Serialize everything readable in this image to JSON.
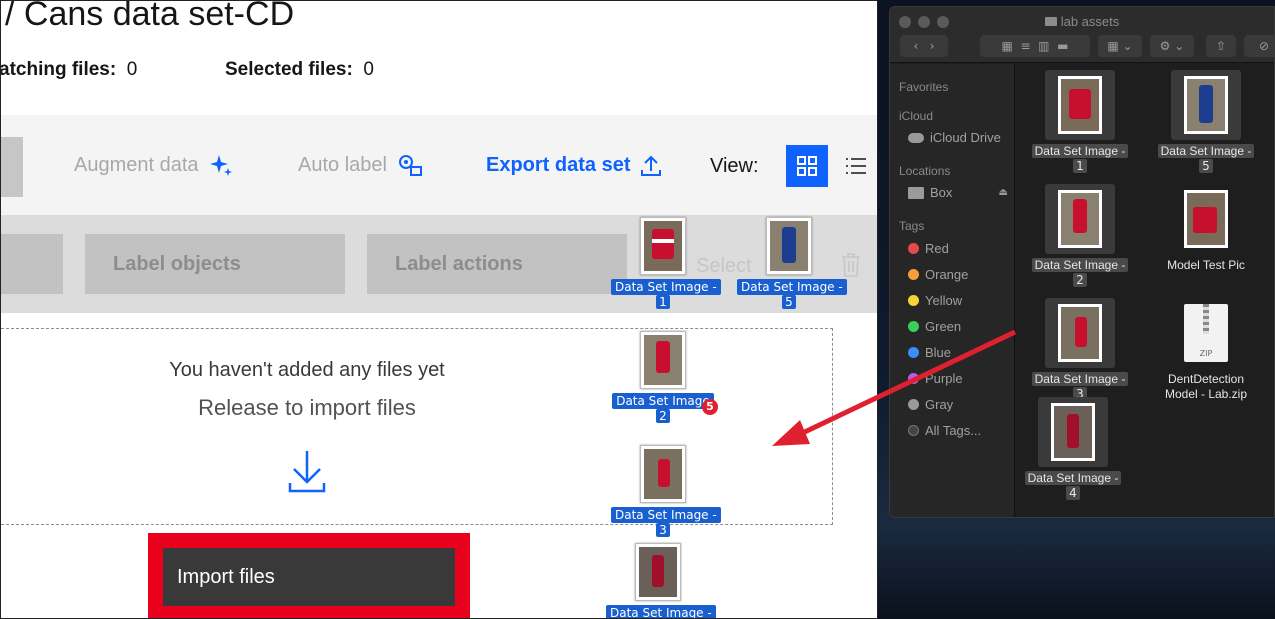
{
  "app": {
    "title": "/ Cans data set-CD",
    "matching_label": "atching files:",
    "matching_value": "0",
    "selected_label": "Selected files:",
    "selected_value": "0",
    "toolbar": {
      "augment": "Augment data",
      "auto_label": "Auto label",
      "export": "Export data set",
      "view_label": "View:"
    },
    "actions": {
      "label_objects": "Label objects",
      "label_actions": "Label actions",
      "select": "Select"
    },
    "dropzone": {
      "line1": "You haven't added any files yet",
      "line2": "Release to import files"
    },
    "import_button": "Import files",
    "drag_ghosts": [
      {
        "label": "Data Set Image -",
        "num": "1"
      },
      {
        "label": "Data Set Image -",
        "num": "5"
      },
      {
        "label": "Data Set Image",
        "num": "2",
        "badge": "5"
      },
      {
        "label": "Data Set Image -",
        "num": "3"
      },
      {
        "label": "Data Set Image -",
        "num": ""
      }
    ]
  },
  "finder": {
    "title": "lab assets",
    "sidebar": {
      "favorites": "Favorites",
      "icloud": "iCloud",
      "icloud_drive": "iCloud Drive",
      "locations": "Locations",
      "box": "Box",
      "tags": "Tags",
      "tag_items": [
        {
          "label": "Red",
          "color": "#e5484d"
        },
        {
          "label": "Orange",
          "color": "#f59e3b"
        },
        {
          "label": "Yellow",
          "color": "#f5d33b"
        },
        {
          "label": "Green",
          "color": "#3bcf5a"
        },
        {
          "label": "Blue",
          "color": "#3b8ef5"
        },
        {
          "label": "Purple",
          "color": "#b65cf0"
        },
        {
          "label": "Gray",
          "color": "#9a9a9a"
        }
      ],
      "all_tags": "All Tags..."
    },
    "files": [
      {
        "name": "Data Set Image -",
        "num": "1"
      },
      {
        "name": "Data Set Image -",
        "num": "5"
      },
      {
        "name": "Data Set Image -",
        "num": "2"
      },
      {
        "name": "Model Test Pic",
        "num": ""
      },
      {
        "name": "Data Set Image -",
        "num": "3"
      },
      {
        "name": "DentDetection Model - Lab.zip",
        "num": ""
      },
      {
        "name": "Data Set Image -",
        "num": "4"
      }
    ],
    "zip_label": "ZIP"
  },
  "colors": {
    "accent": "#0f62fe",
    "highlight": "#e8001c"
  }
}
